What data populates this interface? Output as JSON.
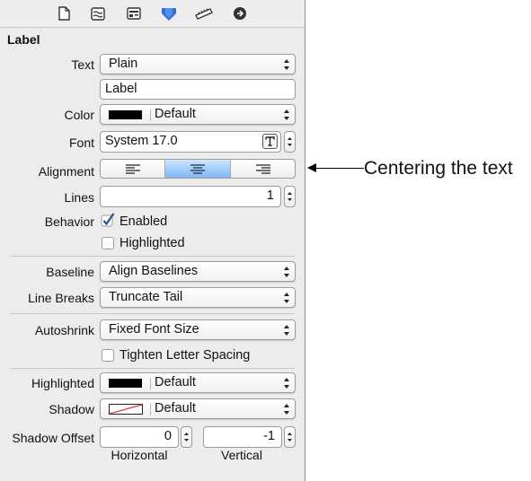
{
  "toolbar": {
    "icons": [
      "file-icon",
      "quick-help-icon",
      "identity-icon",
      "attributes-icon",
      "size-ruler-icon",
      "connections-icon"
    ],
    "selected_index": 3,
    "accent": "#2f6fd6"
  },
  "section": {
    "title": "Label"
  },
  "text": {
    "label": "Text",
    "value": "Plain",
    "content": "Label"
  },
  "color": {
    "label": "Color",
    "value": "Default",
    "swatch": "#000000"
  },
  "font": {
    "label": "Font",
    "value": "System 17.0"
  },
  "alignment": {
    "label": "Alignment",
    "options": [
      "left",
      "center",
      "right"
    ],
    "selected": "center"
  },
  "lines": {
    "label": "Lines",
    "value": "1"
  },
  "behavior": {
    "label": "Behavior",
    "enabled_label": "Enabled",
    "enabled": true,
    "highlighted_label": "Highlighted",
    "highlighted": false
  },
  "baseline": {
    "label": "Baseline",
    "value": "Align Baselines"
  },
  "line_breaks": {
    "label": "Line Breaks",
    "value": "Truncate Tail"
  },
  "autoshrink": {
    "label": "Autoshrink",
    "value": "Fixed Font Size",
    "tighten_label": "Tighten Letter Spacing",
    "tighten": false
  },
  "highlighted": {
    "label": "Highlighted",
    "value": "Default",
    "swatch": "#000000"
  },
  "shadow": {
    "label": "Shadow",
    "value": "Default"
  },
  "shadow_offset": {
    "label": "Shadow Offset",
    "horizontal": "0",
    "vertical": "-1",
    "horizontal_label": "Horizontal",
    "vertical_label": "Vertical"
  },
  "annotation": {
    "text": "Centering the text"
  }
}
